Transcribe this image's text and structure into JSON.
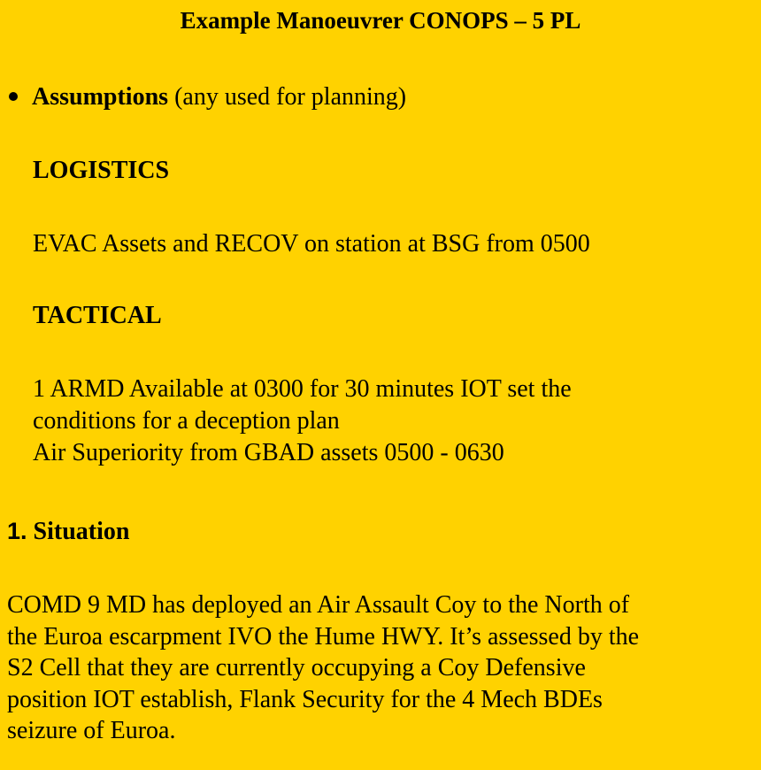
{
  "title": "Example Manoeuvrer CONOPS – 5 PL",
  "assumptions": {
    "label": "Assumptions",
    "note": "(any used for planning)",
    "logistics": {
      "heading": "LOGISTICS",
      "lines": [
        "EVAC Assets and RECOV on station at BSG from 0500"
      ]
    },
    "tactical": {
      "heading": "TACTICAL",
      "lines": [
        "1 ARMD Available at 0300 for 30 minutes IOT set the",
        "conditions for a deception plan",
        "Air Superiority from GBAD assets 0500 - 0630"
      ]
    }
  },
  "situation": {
    "number": "1.",
    "heading": "Situation",
    "lines": [
      "COMD 9 MD has deployed an Air Assault Coy to the North of",
      "the Euroa escarpment IVO the Hume HWY. It’s assessed by the",
      "S2 Cell that they are currently occupying a Coy Defensive",
      "position IOT establish, Flank Security for the 4 Mech BDEs",
      "seizure of Euroa."
    ]
  }
}
